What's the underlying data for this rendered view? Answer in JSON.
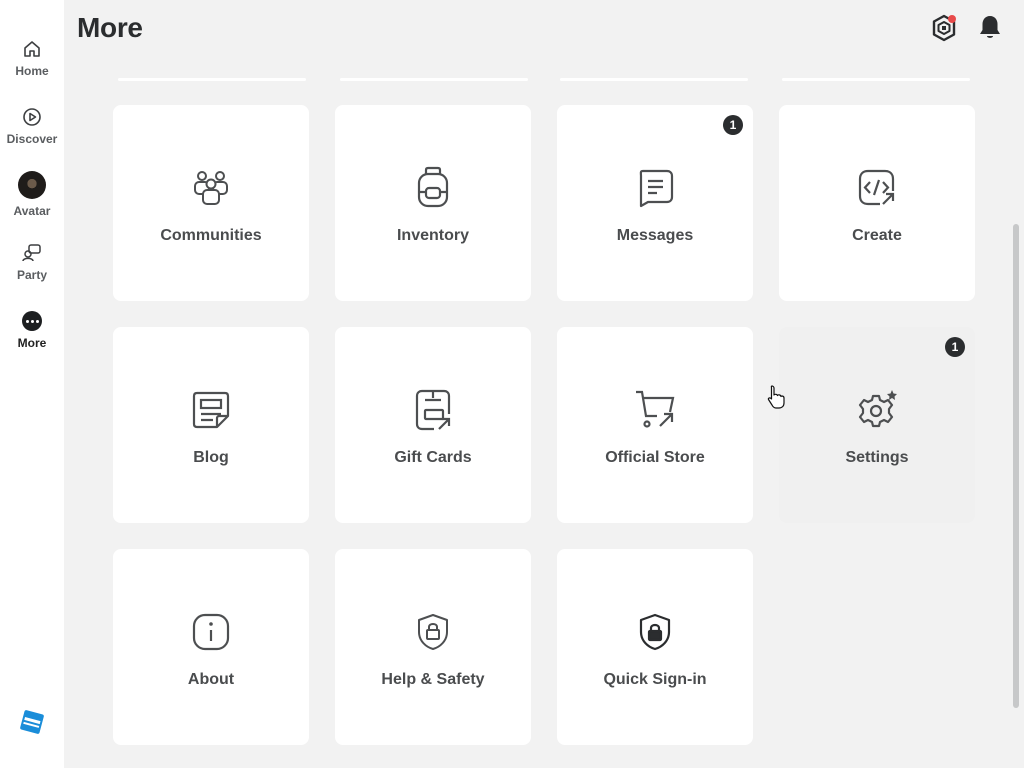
{
  "nav": {
    "home": "Home",
    "discover": "Discover",
    "avatar": "Avatar",
    "party": "Party",
    "more": "More"
  },
  "header": {
    "title": "More"
  },
  "tiles": [
    {
      "label": "Communities",
      "icon": "communities-icon"
    },
    {
      "label": "Inventory",
      "icon": "backpack-icon"
    },
    {
      "label": "Messages",
      "icon": "message-icon",
      "badge": "1"
    },
    {
      "label": "Create",
      "icon": "code-icon"
    },
    {
      "label": "Blog",
      "icon": "blog-icon"
    },
    {
      "label": "Gift Cards",
      "icon": "gift-card-icon"
    },
    {
      "label": "Official Store",
      "icon": "cart-icon"
    },
    {
      "label": "Settings",
      "icon": "gear-icon",
      "badge": "1"
    },
    {
      "label": "About",
      "icon": "info-icon"
    },
    {
      "label": "Help & Safety",
      "icon": "shield-lock-icon"
    },
    {
      "label": "Quick Sign-in",
      "icon": "shield-lock-filled-icon"
    }
  ],
  "colors": {
    "background": "#f2f2f2",
    "tile": "#ffffff",
    "badge": "#2b2d2f",
    "notification_dot": "#e84a4a",
    "logo": "#1a8dd9"
  }
}
